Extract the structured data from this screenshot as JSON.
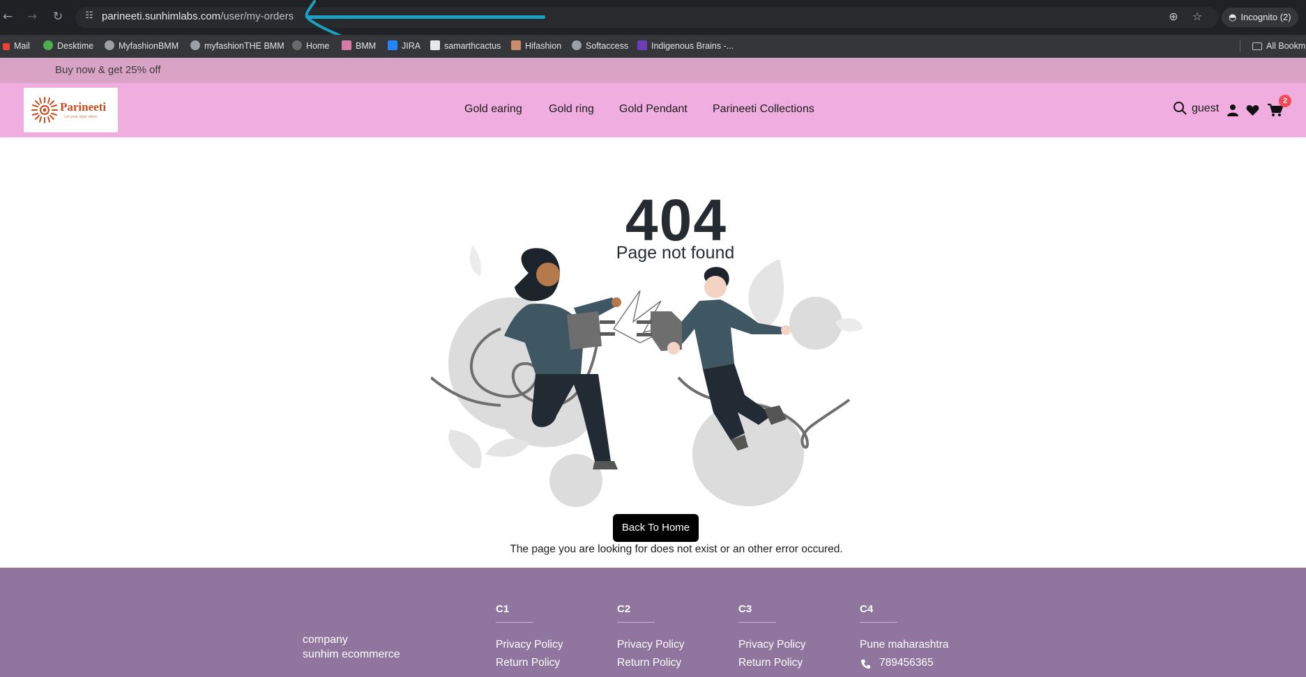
{
  "browser": {
    "url_host": "parineeti.sunhimlabs.com",
    "url_path": "/user/my-orders",
    "incognito_label": "Incognito (2)",
    "bookmarks": [
      "Mail",
      "Desktime",
      "MyfashionBMM",
      "myfashionTHE BMM",
      "Home",
      "BMM",
      "JIRA",
      "samarthcactus",
      "Hifashion",
      "Softaccess",
      "Indigenous Brains -..."
    ],
    "all_bookmarks_label": "All Bookm",
    "annotation_color": "#1aa1c4"
  },
  "promo": {
    "text": "Buy now & get 25% off",
    "bg": "#d8a3c4"
  },
  "header": {
    "bg": "#efaedf",
    "logo_text": "Parineeti",
    "logo_tagline": "Let your style shine",
    "nav": [
      "Gold earing",
      "Gold ring",
      "Gold Pendant",
      "Parineeti Collections"
    ],
    "user_label": "guest",
    "cart_count": "2",
    "icons": [
      "search-icon",
      "user-icon",
      "heart-icon",
      "cart-icon"
    ]
  },
  "error": {
    "code": "404",
    "title": "Page not found",
    "button_label": "Back To Home",
    "description": "The page you are looking for does not exist or an other error occured."
  },
  "footer": {
    "bg": "#90759f",
    "company": [
      "company",
      "sunhim ecommerce"
    ],
    "columns": [
      {
        "heading": "C1",
        "links": [
          "Privacy Policy",
          "Return Policy"
        ]
      },
      {
        "heading": "C2",
        "links": [
          "Privacy Policy",
          "Return Policy"
        ]
      },
      {
        "heading": "C3",
        "links": [
          "Privacy Policy",
          "Return Policy"
        ]
      },
      {
        "heading": "C4",
        "links": [
          "Pune maharashtra",
          "789456365"
        ]
      }
    ]
  }
}
